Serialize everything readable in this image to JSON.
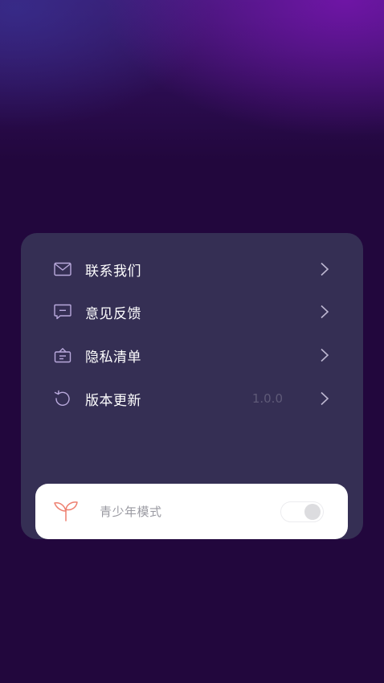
{
  "menu": {
    "items": [
      {
        "label": "联系我们",
        "icon": "mail-icon"
      },
      {
        "label": "意见反馈",
        "icon": "feedback-icon"
      },
      {
        "label": "隐私清单",
        "icon": "privacy-list-icon"
      },
      {
        "label": "版本更新",
        "icon": "refresh-icon",
        "value": "1.0.0"
      }
    ]
  },
  "teen_mode": {
    "label": "青少年模式",
    "enabled": false,
    "icon": "sprout-icon"
  },
  "colors": {
    "background": "#22073d",
    "card": "#352f54",
    "icon_stroke": "#b9a9dc",
    "chevron": "#bdb7d1",
    "teen_icon": "#ee7f6f"
  }
}
